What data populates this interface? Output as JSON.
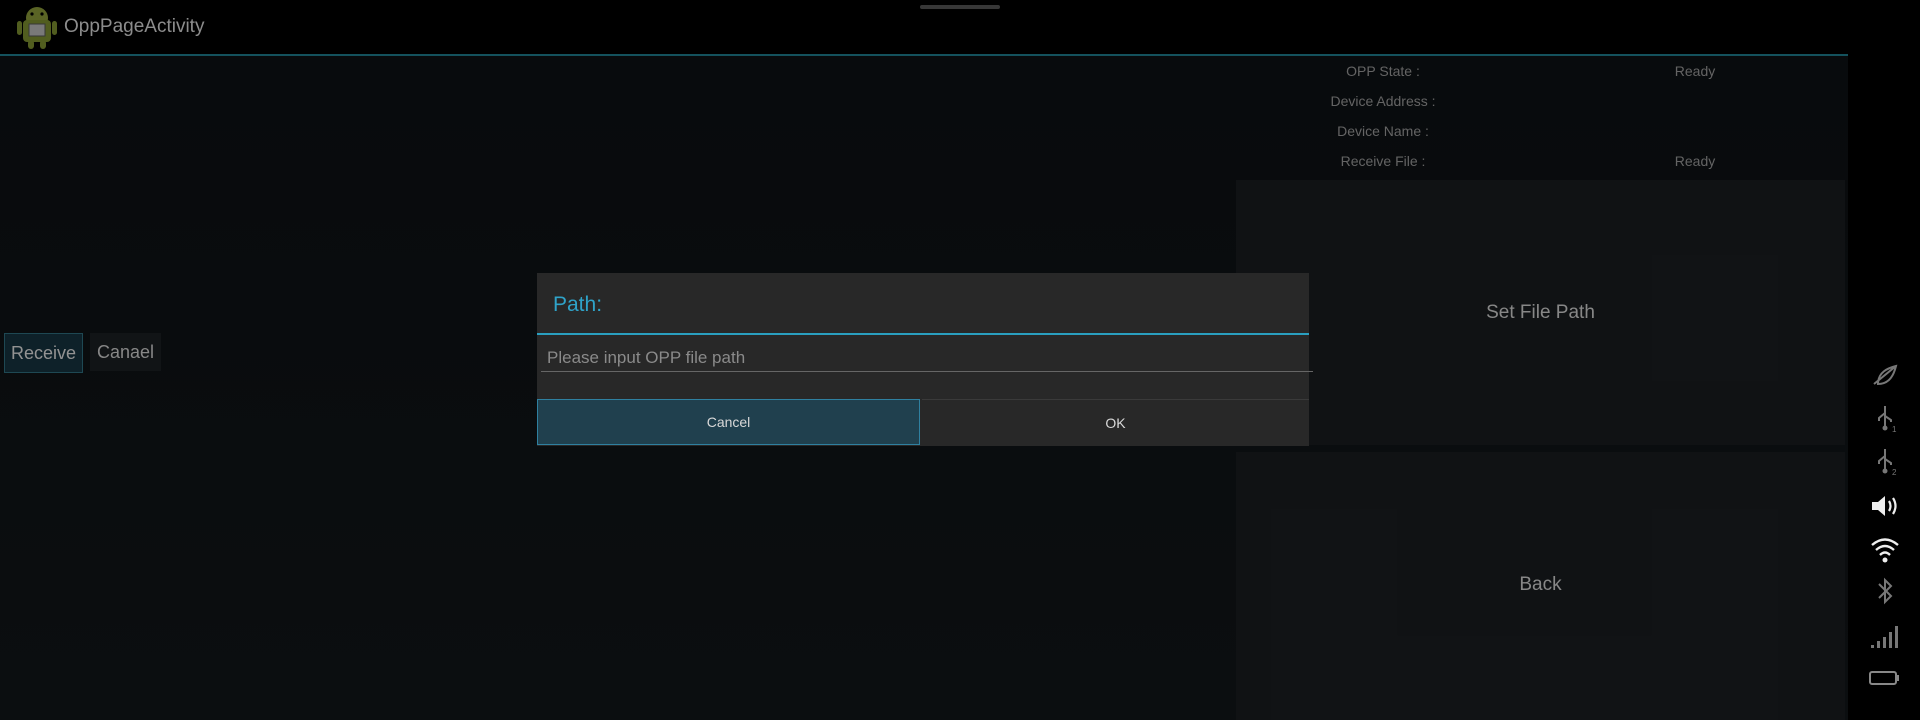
{
  "app": {
    "title": "OppPageActivity"
  },
  "status": {
    "rows": [
      {
        "label": "OPP State :",
        "value": "Ready"
      },
      {
        "label": "Device Address :",
        "value": ""
      },
      {
        "label": "Device Name :",
        "value": ""
      },
      {
        "label": "Receive File :",
        "value": "Ready"
      }
    ]
  },
  "left_buttons": {
    "receive": "Receive",
    "canael": "Canael"
  },
  "panels": {
    "set_file_path": "Set File Path",
    "back": "Back"
  },
  "dialog": {
    "title": "Path:",
    "input_placeholder": "Please input OPP file path",
    "input_value": "",
    "cancel": "Cancel",
    "ok": "OK"
  },
  "system_bar": {
    "icons": [
      "dismiss-leaf-icon",
      "usb-1-icon",
      "usb-2-icon",
      "volume-icon",
      "wifi-icon",
      "bluetooth-icon",
      "signal-icon",
      "battery-icon"
    ]
  },
  "colors": {
    "accent": "#2fa3c9",
    "divider": "#1f7f8f"
  }
}
